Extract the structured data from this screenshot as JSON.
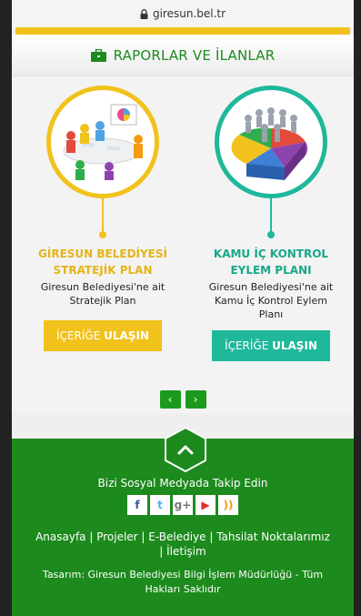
{
  "browser": {
    "url": "giresun.bel.tr"
  },
  "section": {
    "title": "RAPORLAR VE İLANLAR"
  },
  "cards": [
    {
      "title_line1": "GİRESUN BELEDİYESİ",
      "title_line2": "STRATEJİK PLAN",
      "desc_line1": "Giresun Belediyesi'ne ait",
      "desc_line2": "Stratejik Plan",
      "desc_line3": "",
      "cta_prefix": "İÇERİĞE ",
      "cta_bold": "ULAŞIN",
      "accent": "#f2c21c"
    },
    {
      "title_line1": "KAMU İÇ KONTROL",
      "title_line2": "EYLEM PLANI",
      "desc_line1": "Giresun Belediyesi'ne ait",
      "desc_line2": "Kamu İç Kontrol Eylem",
      "desc_line3": "Planı",
      "cta_prefix": "İÇERİĞE ",
      "cta_bold": "ULAŞIN",
      "accent": "#1fb89a"
    }
  ],
  "carousel": {
    "prev": "‹",
    "next": "›"
  },
  "footer": {
    "follow_text": "Bizi Sosyal Medyada Takip Edin",
    "social": [
      {
        "label": "f",
        "icon": "facebook-icon",
        "color": "#3b5998"
      },
      {
        "label": "t",
        "icon": "twitter-icon",
        "color": "#55acee"
      },
      {
        "label": "g+",
        "icon": "google-plus-icon",
        "color": "#777777"
      },
      {
        "label": "▶",
        "icon": "youtube-icon",
        "color": "#e52d27"
      },
      {
        "label": "))",
        "icon": "rss-icon",
        "color": "#f39c12"
      }
    ],
    "links_line1": "Anasayfa  |  Projeler  |  E-Belediye  |  Tahsilat Noktalarımız",
    "links_line2": "|  İletişim",
    "credits_line1": "Tasarım: Giresun Belediyesi Bilgi İşlem Müdürlüğü - Tüm",
    "credits_line2": "Hakları Saklıdır"
  },
  "colors": {
    "brand_green": "#1d8a1d",
    "yellow": "#f2c21c",
    "teal": "#1fb89a"
  }
}
